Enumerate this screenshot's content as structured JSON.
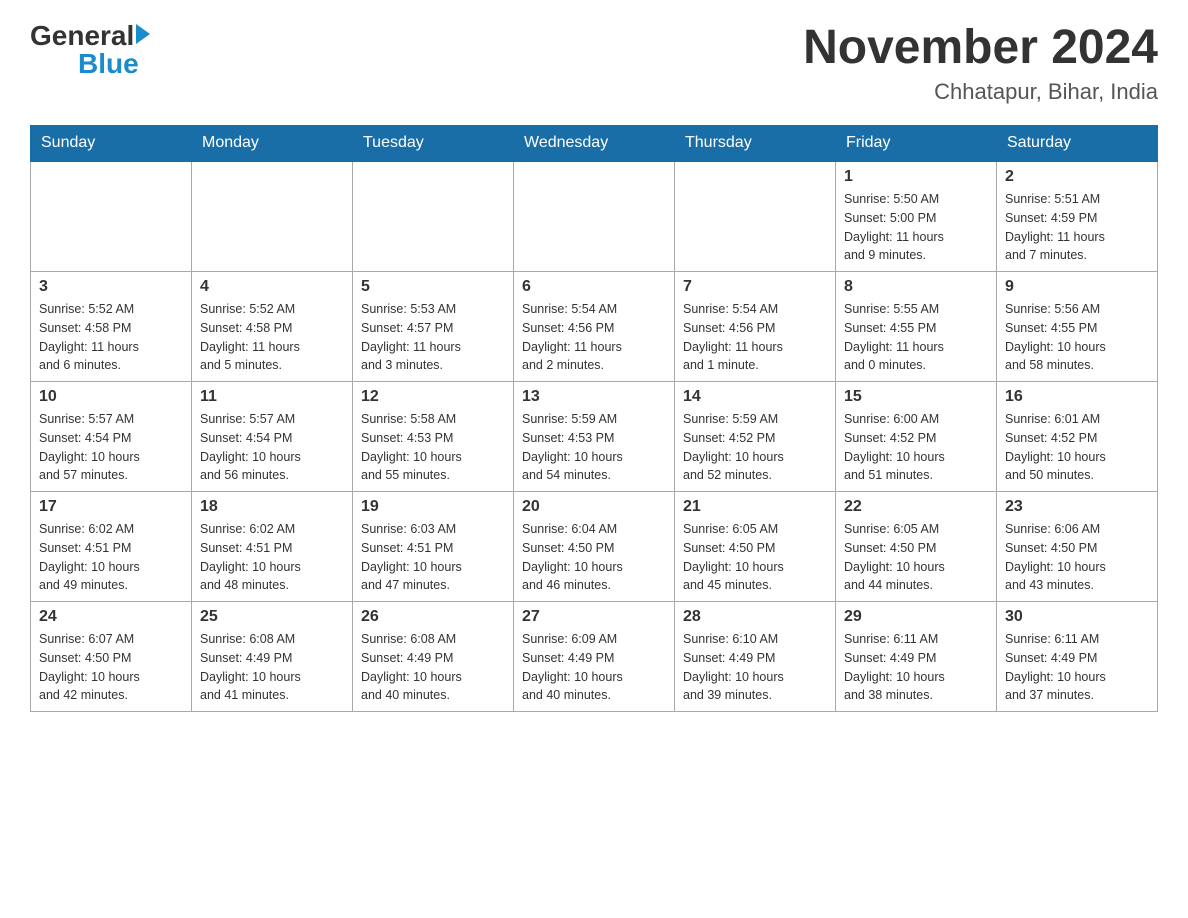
{
  "logo": {
    "general": "General",
    "blue": "Blue"
  },
  "header": {
    "title": "November 2024",
    "subtitle": "Chhatapur, Bihar, India"
  },
  "weekdays": [
    "Sunday",
    "Monday",
    "Tuesday",
    "Wednesday",
    "Thursday",
    "Friday",
    "Saturday"
  ],
  "weeks": [
    [
      {
        "day": "",
        "info": ""
      },
      {
        "day": "",
        "info": ""
      },
      {
        "day": "",
        "info": ""
      },
      {
        "day": "",
        "info": ""
      },
      {
        "day": "",
        "info": ""
      },
      {
        "day": "1",
        "info": "Sunrise: 5:50 AM\nSunset: 5:00 PM\nDaylight: 11 hours\nand 9 minutes."
      },
      {
        "day": "2",
        "info": "Sunrise: 5:51 AM\nSunset: 4:59 PM\nDaylight: 11 hours\nand 7 minutes."
      }
    ],
    [
      {
        "day": "3",
        "info": "Sunrise: 5:52 AM\nSunset: 4:58 PM\nDaylight: 11 hours\nand 6 minutes."
      },
      {
        "day": "4",
        "info": "Sunrise: 5:52 AM\nSunset: 4:58 PM\nDaylight: 11 hours\nand 5 minutes."
      },
      {
        "day": "5",
        "info": "Sunrise: 5:53 AM\nSunset: 4:57 PM\nDaylight: 11 hours\nand 3 minutes."
      },
      {
        "day": "6",
        "info": "Sunrise: 5:54 AM\nSunset: 4:56 PM\nDaylight: 11 hours\nand 2 minutes."
      },
      {
        "day": "7",
        "info": "Sunrise: 5:54 AM\nSunset: 4:56 PM\nDaylight: 11 hours\nand 1 minute."
      },
      {
        "day": "8",
        "info": "Sunrise: 5:55 AM\nSunset: 4:55 PM\nDaylight: 11 hours\nand 0 minutes."
      },
      {
        "day": "9",
        "info": "Sunrise: 5:56 AM\nSunset: 4:55 PM\nDaylight: 10 hours\nand 58 minutes."
      }
    ],
    [
      {
        "day": "10",
        "info": "Sunrise: 5:57 AM\nSunset: 4:54 PM\nDaylight: 10 hours\nand 57 minutes."
      },
      {
        "day": "11",
        "info": "Sunrise: 5:57 AM\nSunset: 4:54 PM\nDaylight: 10 hours\nand 56 minutes."
      },
      {
        "day": "12",
        "info": "Sunrise: 5:58 AM\nSunset: 4:53 PM\nDaylight: 10 hours\nand 55 minutes."
      },
      {
        "day": "13",
        "info": "Sunrise: 5:59 AM\nSunset: 4:53 PM\nDaylight: 10 hours\nand 54 minutes."
      },
      {
        "day": "14",
        "info": "Sunrise: 5:59 AM\nSunset: 4:52 PM\nDaylight: 10 hours\nand 52 minutes."
      },
      {
        "day": "15",
        "info": "Sunrise: 6:00 AM\nSunset: 4:52 PM\nDaylight: 10 hours\nand 51 minutes."
      },
      {
        "day": "16",
        "info": "Sunrise: 6:01 AM\nSunset: 4:52 PM\nDaylight: 10 hours\nand 50 minutes."
      }
    ],
    [
      {
        "day": "17",
        "info": "Sunrise: 6:02 AM\nSunset: 4:51 PM\nDaylight: 10 hours\nand 49 minutes."
      },
      {
        "day": "18",
        "info": "Sunrise: 6:02 AM\nSunset: 4:51 PM\nDaylight: 10 hours\nand 48 minutes."
      },
      {
        "day": "19",
        "info": "Sunrise: 6:03 AM\nSunset: 4:51 PM\nDaylight: 10 hours\nand 47 minutes."
      },
      {
        "day": "20",
        "info": "Sunrise: 6:04 AM\nSunset: 4:50 PM\nDaylight: 10 hours\nand 46 minutes."
      },
      {
        "day": "21",
        "info": "Sunrise: 6:05 AM\nSunset: 4:50 PM\nDaylight: 10 hours\nand 45 minutes."
      },
      {
        "day": "22",
        "info": "Sunrise: 6:05 AM\nSunset: 4:50 PM\nDaylight: 10 hours\nand 44 minutes."
      },
      {
        "day": "23",
        "info": "Sunrise: 6:06 AM\nSunset: 4:50 PM\nDaylight: 10 hours\nand 43 minutes."
      }
    ],
    [
      {
        "day": "24",
        "info": "Sunrise: 6:07 AM\nSunset: 4:50 PM\nDaylight: 10 hours\nand 42 minutes."
      },
      {
        "day": "25",
        "info": "Sunrise: 6:08 AM\nSunset: 4:49 PM\nDaylight: 10 hours\nand 41 minutes."
      },
      {
        "day": "26",
        "info": "Sunrise: 6:08 AM\nSunset: 4:49 PM\nDaylight: 10 hours\nand 40 minutes."
      },
      {
        "day": "27",
        "info": "Sunrise: 6:09 AM\nSunset: 4:49 PM\nDaylight: 10 hours\nand 40 minutes."
      },
      {
        "day": "28",
        "info": "Sunrise: 6:10 AM\nSunset: 4:49 PM\nDaylight: 10 hours\nand 39 minutes."
      },
      {
        "day": "29",
        "info": "Sunrise: 6:11 AM\nSunset: 4:49 PM\nDaylight: 10 hours\nand 38 minutes."
      },
      {
        "day": "30",
        "info": "Sunrise: 6:11 AM\nSunset: 4:49 PM\nDaylight: 10 hours\nand 37 minutes."
      }
    ]
  ]
}
